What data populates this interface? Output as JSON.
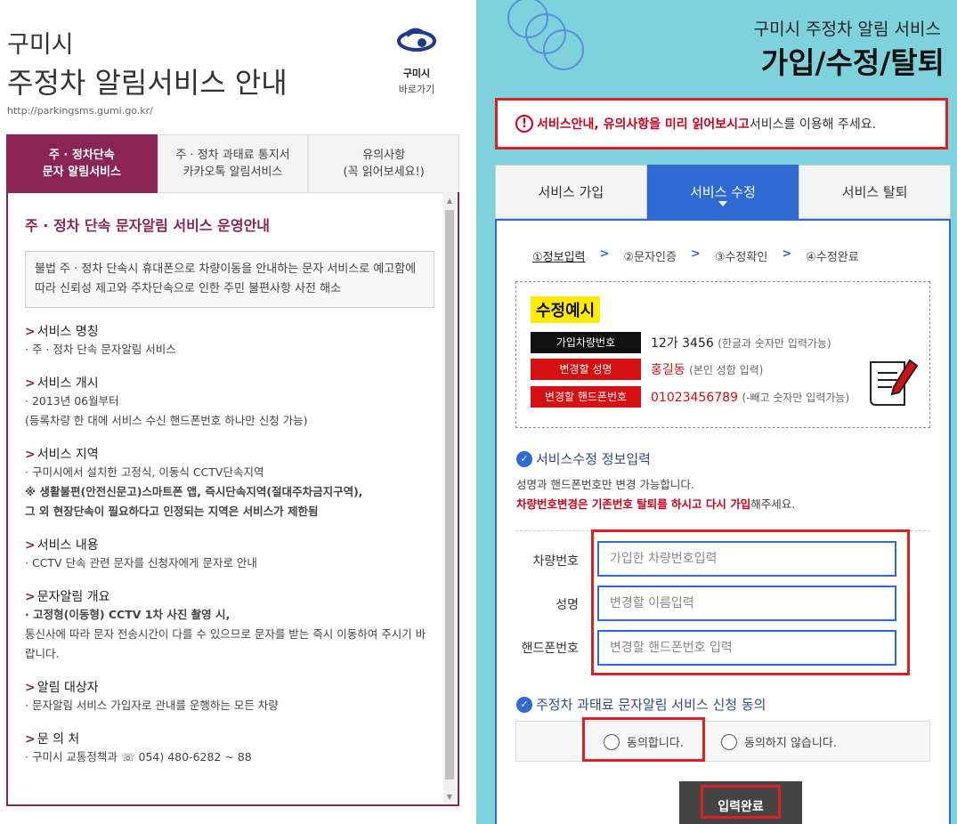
{
  "left": {
    "city": "구미시",
    "title": "주정차 알림서비스 안내",
    "url": "http://parkingsms.gumi.go.kr/",
    "logo": {
      "name": "구미시",
      "shortcut": "바로가기"
    },
    "tabs": [
      {
        "line1": "주 · 정차단속",
        "line2": "문자 알림서비스"
      },
      {
        "line1": "주 · 정차 과태료 통지서",
        "line2": "카카오톡 알림서비스"
      },
      {
        "line1": "유의사항",
        "line2": "(꼭 읽어보세요!)"
      }
    ],
    "panel": {
      "title": "주 · 정차 단속 문자알림 서비스 운영안내",
      "intro": "불법 주 · 정차 단속시 휴대폰으로 차량이동을 안내하는 문자 서비스로 예고함에 따라 신뢰성 제고와 주차단속으로 인한 주민 불편사항 사전 해소",
      "s1_h": "서비스 명칭",
      "s1_b": "· 주 · 정차 단속 문자알림 서비스",
      "s2_h": "서비스 개시",
      "s2_b1": "· 2013년 06월부터",
      "s2_b2": "(등록차량 한 대에 서비스 수신 핸드폰번호 하나만 신청 가능)",
      "s3_h": "서비스 지역",
      "s3_b": "· 구미시에서 설치한 고정식, 이동식 CCTV단속지역",
      "s3_r1": "※ 생활불편(안전신문고)스마트폰 앱, 즉시단속지역(절대주차금지구역),",
      "s3_r2": "그 외 현장단속이 필요하다고 인정되는 지역은 서비스가 제한됨",
      "s4_h": "서비스 내용",
      "s4_b": "· CCTV 단속 관련 문자를 신청자에게 문자로 안내",
      "s5_h": "문자알림 개요",
      "s5_r": "· 고정형(이동형) CCTV 1차 사진 촬영 시,",
      "s5_b": "통신사에 따라 문자 전송시간이 다를 수 있으므로 문자를 받는 즉시 이동하여 주시기 바랍니다.",
      "s6_h": "알림 대상자",
      "s6_b": "· 문자알림 서비스 가입자로 관내를 운행하는 모든 차량",
      "s7_h": "문 의 처",
      "s7_b": "· 구미시 교통정책과 ☏ 054) 480-6282 ~ 88",
      "gt": ">"
    }
  },
  "right": {
    "subtitle": "구미시 주정차 알림 서비스",
    "title": "가입/수정/탈퇴",
    "notice": {
      "icon": "!",
      "red": "서비스안내, 유의사항을 미리 읽어보시고",
      "rest": " 서비스를 이용해 주세요."
    },
    "tabs": [
      "서비스 가입",
      "서비스 수정",
      "서비스 탈퇴"
    ],
    "steps": [
      "①정보입력",
      "②문자인증",
      "③수정확인",
      "④수정완료"
    ],
    "step_sep": ">",
    "example": {
      "title": "수정예시",
      "rows": [
        {
          "label": "가입차량번호",
          "value": "12가 3456",
          "hint": "(한글과 숫자만 입력가능)"
        },
        {
          "label": "변경할 성명",
          "value": "홍길동",
          "hint": "(본인 성함 입력)"
        },
        {
          "label": "변경할 핸드폰번호",
          "value": "01023456789",
          "hint": "(-빼고 숫자만 입력가능)"
        }
      ]
    },
    "section1": "서비스수정 정보입력",
    "desc1": "성명과 핸드폰번호만 변경 가능합니다.",
    "desc2_red": "차량번호변경은 기존번호 탈퇴를 하시고 다시 가입",
    "desc2_rest": "해주세요.",
    "fields": [
      {
        "label": "차량번호",
        "placeholder": "가입한 차량번호입력"
      },
      {
        "label": "성명",
        "placeholder": "변경할 이름입력"
      },
      {
        "label": "핸드폰번호",
        "placeholder": "변경할 핸드폰번호 입력"
      }
    ],
    "section2": "주정차 과태료 문자알림 서비스 신청 동의",
    "agree": "동의합니다.",
    "disagree": "동의하지 않습니다.",
    "submit": "입력완료",
    "check": "✓"
  },
  "colors": {
    "brand": "#8a2454",
    "blue": "#2d6ad4",
    "bg": "#7ed2dc",
    "red": "#d0021b"
  },
  "icons": [
    "gumi-logo-icon",
    "exclamation-icon",
    "check-circle-icon",
    "document-pen-icon",
    "radio-icon",
    "scroll-arrow-icon"
  ]
}
